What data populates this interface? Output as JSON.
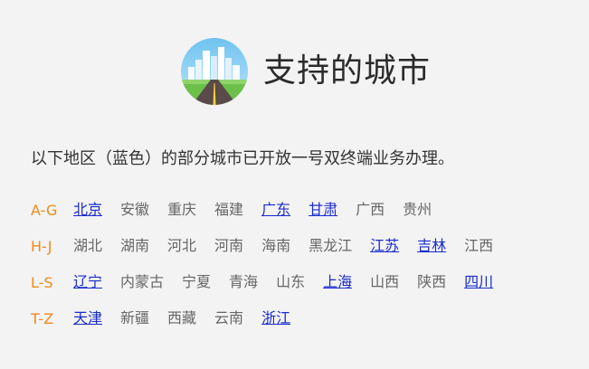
{
  "header": {
    "title": "支持的城市",
    "logo_icon": "city-road-icon"
  },
  "intro_text": "以下地区（蓝色）的部分城市已开放一号双终端业务办理。",
  "colors": {
    "range_label": "#f08a1a",
    "open_city": "#1a2ccc",
    "closed_city": "#666666",
    "background": "#f3f3f4"
  },
  "groups": [
    {
      "range": "A-G",
      "cities": [
        {
          "name": "北京",
          "open": true
        },
        {
          "name": "安徽",
          "open": false
        },
        {
          "name": "重庆",
          "open": false
        },
        {
          "name": "福建",
          "open": false
        },
        {
          "name": "广东",
          "open": true
        },
        {
          "name": "甘肃",
          "open": true
        },
        {
          "name": "广西",
          "open": false
        },
        {
          "name": "贵州",
          "open": false
        }
      ]
    },
    {
      "range": "H-J",
      "cities": [
        {
          "name": "湖北",
          "open": false
        },
        {
          "name": "湖南",
          "open": false
        },
        {
          "name": "河北",
          "open": false
        },
        {
          "name": "河南",
          "open": false
        },
        {
          "name": "海南",
          "open": false
        },
        {
          "name": "黑龙江",
          "open": false
        },
        {
          "name": "江苏",
          "open": true
        },
        {
          "name": "吉林",
          "open": true
        },
        {
          "name": "江西",
          "open": false
        }
      ]
    },
    {
      "range": "L-S",
      "cities": [
        {
          "name": "辽宁",
          "open": true
        },
        {
          "name": "内蒙古",
          "open": false
        },
        {
          "name": "宁夏",
          "open": false
        },
        {
          "name": "青海",
          "open": false
        },
        {
          "name": "山东",
          "open": false
        },
        {
          "name": "上海",
          "open": true
        },
        {
          "name": "山西",
          "open": false
        },
        {
          "name": "陕西",
          "open": false
        },
        {
          "name": "四川",
          "open": true
        }
      ]
    },
    {
      "range": "T-Z",
      "cities": [
        {
          "name": "天津",
          "open": true
        },
        {
          "name": "新疆",
          "open": false
        },
        {
          "name": "西藏",
          "open": false
        },
        {
          "name": "云南",
          "open": false
        },
        {
          "name": "浙江",
          "open": true
        }
      ]
    }
  ]
}
